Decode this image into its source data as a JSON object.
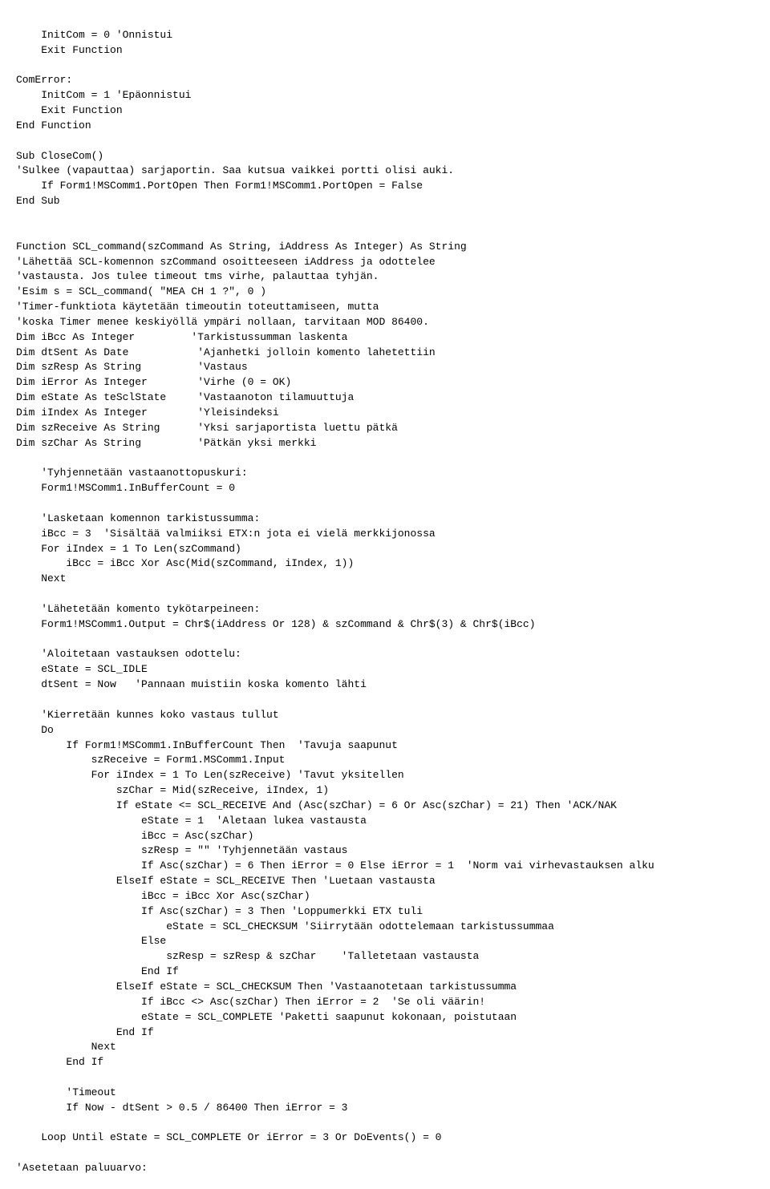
{
  "code": {
    "lines": [
      {
        "text": "    InitCom = 0 'Onnistui",
        "type": "code"
      },
      {
        "text": "    Exit Function",
        "type": "code"
      },
      {
        "text": "",
        "type": "code"
      },
      {
        "text": "ComError:",
        "type": "code"
      },
      {
        "text": "    InitCom = 1 'Epäonnistui",
        "type": "code"
      },
      {
        "text": "    Exit Function",
        "type": "code"
      },
      {
        "text": "End Function",
        "type": "code"
      },
      {
        "text": "",
        "type": "code"
      },
      {
        "text": "Sub CloseCom()",
        "type": "code"
      },
      {
        "text": "'Sulkee (vapauttaa) sarjaportin. Saa kutsua vaikkei portti olisi auki.",
        "type": "code"
      },
      {
        "text": "    If Form1!MSComm1.PortOpen Then Form1!MSComm1.PortOpen = False",
        "type": "code"
      },
      {
        "text": "End Sub",
        "type": "code"
      },
      {
        "text": "",
        "type": "code"
      },
      {
        "text": "",
        "type": "code"
      },
      {
        "text": "Function SCL_command(szCommand As String, iAddress As Integer) As String",
        "type": "code"
      },
      {
        "text": "'Lähettää SCL-komennon szCommand osoitteeseen iAddress ja odottelee",
        "type": "code"
      },
      {
        "text": "'vastausta. Jos tulee timeout tms virhe, palauttaa tyhjän.",
        "type": "code"
      },
      {
        "text": "'Esim s = SCL_command( \"MEA CH 1 ?\", 0 )",
        "type": "code"
      },
      {
        "text": "'Timer-funktiota käytetään timeoutin toteuttamiseen, mutta",
        "type": "code"
      },
      {
        "text": "'koska Timer menee keskiyöllä ympäri nollaan, tarvitaan MOD 86400.",
        "type": "code"
      },
      {
        "text": "Dim iBcc As Integer         'Tarkistussumman laskenta",
        "type": "code"
      },
      {
        "text": "Dim dtSent As Date           'Ajanhetki jolloin komento lahetettiin",
        "type": "code"
      },
      {
        "text": "Dim szResp As String         'Vastaus",
        "type": "code"
      },
      {
        "text": "Dim iError As Integer        'Virhe (0 = OK)",
        "type": "code"
      },
      {
        "text": "Dim eState As teSclState     'Vastaanoton tilamuuttuja",
        "type": "code"
      },
      {
        "text": "Dim iIndex As Integer        'Yleisindeksi",
        "type": "code"
      },
      {
        "text": "Dim szReceive As String      'Yksi sarjaportista luettu pätkä",
        "type": "code"
      },
      {
        "text": "Dim szChar As String         'Pätkän yksi merkki",
        "type": "code"
      },
      {
        "text": "",
        "type": "code"
      },
      {
        "text": "    'Tyhjennetään vastaanottopuskuri:",
        "type": "code"
      },
      {
        "text": "    Form1!MSComm1.InBufferCount = 0",
        "type": "code"
      },
      {
        "text": "",
        "type": "code"
      },
      {
        "text": "    'Lasketaan komennon tarkistussumma:",
        "type": "code"
      },
      {
        "text": "    iBcc = 3  'Sisältää valmiiksi ETX:n jota ei vielä merkkijonossa",
        "type": "code"
      },
      {
        "text": "    For iIndex = 1 To Len(szCommand)",
        "type": "code"
      },
      {
        "text": "        iBcc = iBcc Xor Asc(Mid(szCommand, iIndex, 1))",
        "type": "code"
      },
      {
        "text": "    Next",
        "type": "code"
      },
      {
        "text": "",
        "type": "code"
      },
      {
        "text": "    'Lähetetään komento tykötarpeineen:",
        "type": "code"
      },
      {
        "text": "    Form1!MSComm1.Output = Chr$(iAddress Or 128) & szCommand & Chr$(3) & Chr$(iBcc)",
        "type": "code"
      },
      {
        "text": "",
        "type": "code"
      },
      {
        "text": "    'Aloitetaan vastauksen odottelu:",
        "type": "code"
      },
      {
        "text": "    eState = SCL_IDLE",
        "type": "code"
      },
      {
        "text": "    dtSent = Now   'Pannaan muistiin koska komento lähti",
        "type": "code"
      },
      {
        "text": "",
        "type": "code"
      },
      {
        "text": "    'Kierretään kunnes koko vastaus tullut",
        "type": "code"
      },
      {
        "text": "    Do",
        "type": "code"
      },
      {
        "text": "        If Form1!MSComm1.InBufferCount Then  'Tavuja saapunut",
        "type": "code"
      },
      {
        "text": "            szReceive = Form1.MSComm1.Input",
        "type": "code"
      },
      {
        "text": "            For iIndex = 1 To Len(szReceive) 'Tavut yksitellen",
        "type": "code"
      },
      {
        "text": "                szChar = Mid(szReceive, iIndex, 1)",
        "type": "code"
      },
      {
        "text": "                If eState <= SCL_RECEIVE And (Asc(szChar) = 6 Or Asc(szChar) = 21) Then 'ACK/NAK",
        "type": "code"
      },
      {
        "text": "                    eState = 1  'Aletaan lukea vastausta",
        "type": "code"
      },
      {
        "text": "                    iBcc = Asc(szChar)",
        "type": "code"
      },
      {
        "text": "                    szResp = \"\" 'Tyhjennetään vastaus",
        "type": "code"
      },
      {
        "text": "                    If Asc(szChar) = 6 Then iError = 0 Else iError = 1  'Norm vai virhevastauksen alku",
        "type": "code"
      },
      {
        "text": "                ElseIf eState = SCL_RECEIVE Then 'Luetaan vastausta",
        "type": "code"
      },
      {
        "text": "                    iBcc = iBcc Xor Asc(szChar)",
        "type": "code"
      },
      {
        "text": "                    If Asc(szChar) = 3 Then 'Loppumerkki ETX tuli",
        "type": "code"
      },
      {
        "text": "                        eState = SCL_CHECKSUM 'Siirrytään odottelemaan tarkistussummaa",
        "type": "code"
      },
      {
        "text": "                    Else",
        "type": "code"
      },
      {
        "text": "                        szResp = szResp & szChar    'Talletetaan vastausta",
        "type": "code"
      },
      {
        "text": "                    End If",
        "type": "code"
      },
      {
        "text": "                ElseIf eState = SCL_CHECKSUM Then 'Vastaanotetaan tarkistussumma",
        "type": "code"
      },
      {
        "text": "                    If iBcc <> Asc(szChar) Then iError = 2  'Se oli väärin!",
        "type": "code"
      },
      {
        "text": "                    eState = SCL_COMPLETE 'Paketti saapunut kokonaan, poistutaan",
        "type": "code"
      },
      {
        "text": "                End If",
        "type": "code"
      },
      {
        "text": "            Next",
        "type": "code"
      },
      {
        "text": "        End If",
        "type": "code"
      },
      {
        "text": "",
        "type": "code"
      },
      {
        "text": "        'Timeout",
        "type": "code"
      },
      {
        "text": "        If Now - dtSent > 0.5 / 86400 Then iError = 3",
        "type": "code"
      },
      {
        "text": "",
        "type": "code"
      },
      {
        "text": "    Loop Until eState = SCL_COMPLETE Or iError = 3 Or DoEvents() = 0",
        "type": "code"
      },
      {
        "text": "",
        "type": "code"
      },
      {
        "text": "'Asetetaan paluuarvo:",
        "type": "code"
      }
    ]
  }
}
